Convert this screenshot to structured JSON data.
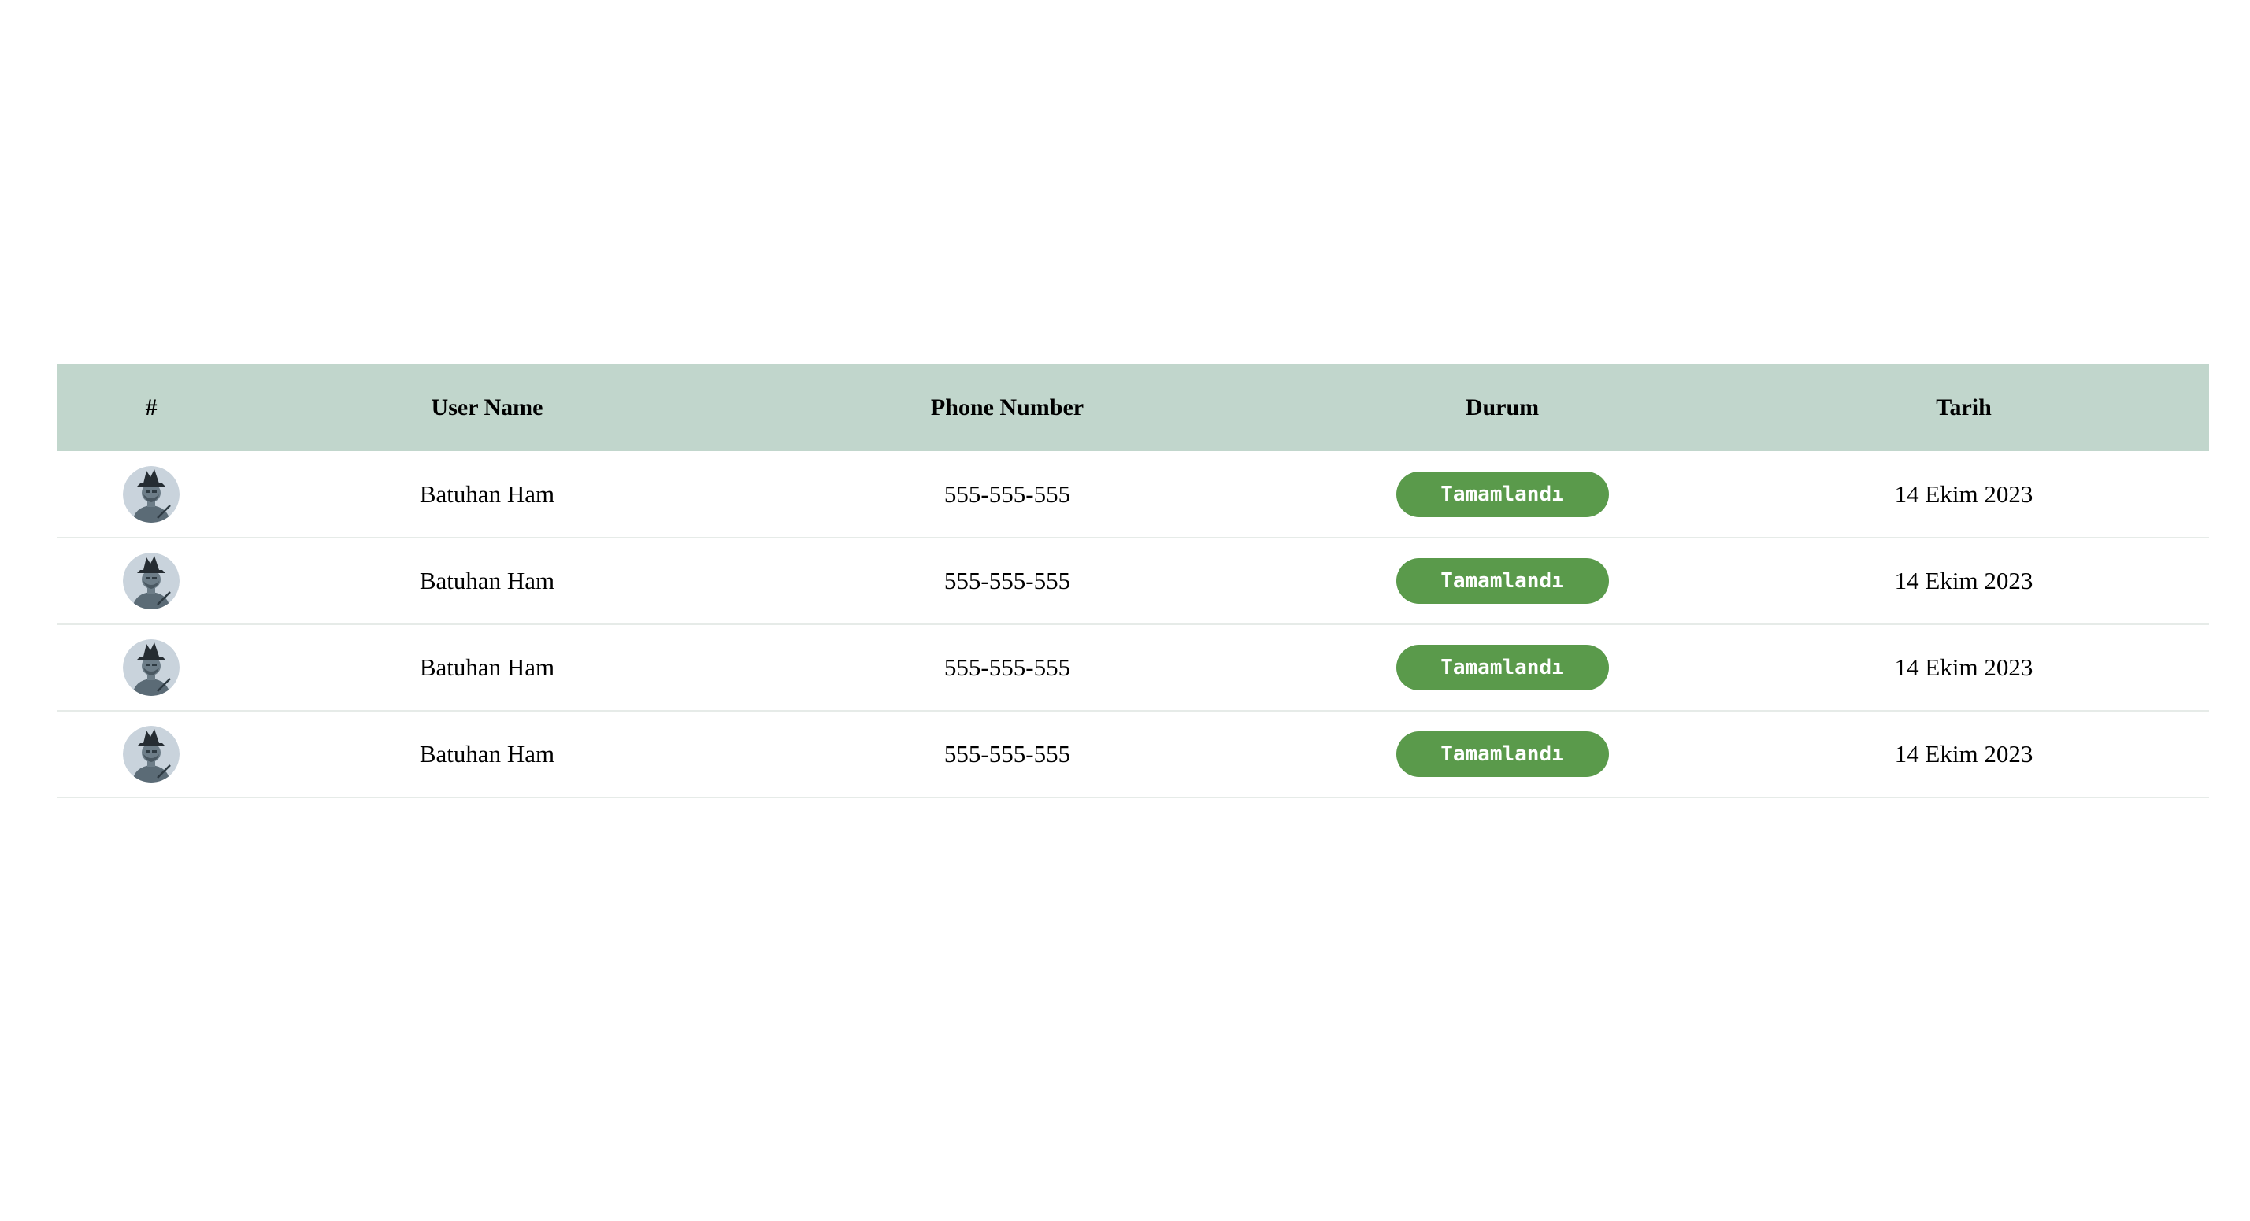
{
  "table": {
    "headers": {
      "index": "#",
      "user_name": "User Name",
      "phone": "Phone Number",
      "status": "Durum",
      "date": "Tarih"
    },
    "rows": [
      {
        "avatar_icon": "user-avatar-icon",
        "user_name": "Batuhan Ham",
        "phone": "555-555-555",
        "status": "Tamamlandı",
        "date": "14 Ekim 2023"
      },
      {
        "avatar_icon": "user-avatar-icon",
        "user_name": "Batuhan Ham",
        "phone": "555-555-555",
        "status": "Tamamlandı",
        "date": "14 Ekim 2023"
      },
      {
        "avatar_icon": "user-avatar-icon",
        "user_name": "Batuhan Ham",
        "phone": "555-555-555",
        "status": "Tamamlandı",
        "date": "14 Ekim 2023"
      },
      {
        "avatar_icon": "user-avatar-icon",
        "user_name": "Batuhan Ham",
        "phone": "555-555-555",
        "status": "Tamamlandı",
        "date": "14 Ekim 2023"
      }
    ]
  },
  "colors": {
    "header_bg": "#c1d6cc",
    "status_badge_bg": "#5a9a4b",
    "status_badge_text": "#ffffff",
    "row_divider": "#e6ebe8",
    "avatar_bg": "#c9d3dc"
  }
}
